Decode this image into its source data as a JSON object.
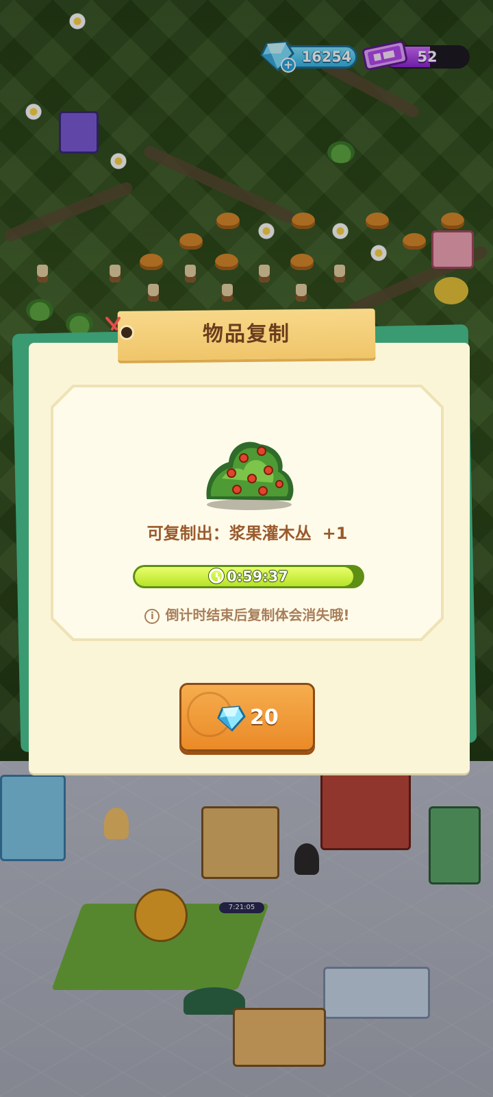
{
  "hud": {
    "gems": "16254",
    "gems_plus": "+",
    "tickets": "52"
  },
  "dialog": {
    "title": "物品复制",
    "copy_label": "可复制出：浆果灌木丛",
    "copy_amount": "+1",
    "timer": "0:59:37",
    "timer_progress": 0.96,
    "notice": "倒计时结束后复制体会消失哦!",
    "info_symbol": "i",
    "price": "20"
  },
  "world": {
    "building_timer": "7:21:05"
  },
  "icons": {
    "gem": "gem-icon",
    "ticket": "ticket-icon",
    "clock": "clock-icon",
    "info": "info-icon",
    "item": "berry-bush-icon"
  },
  "colors": {
    "modal_bg": "#fbf5d8",
    "title_tab": "#f0c56a",
    "title_text": "#6b3d1d",
    "timer_fill": "#c6ea3a",
    "button": "#ea8a27",
    "accent_green": "#3a9a72"
  }
}
